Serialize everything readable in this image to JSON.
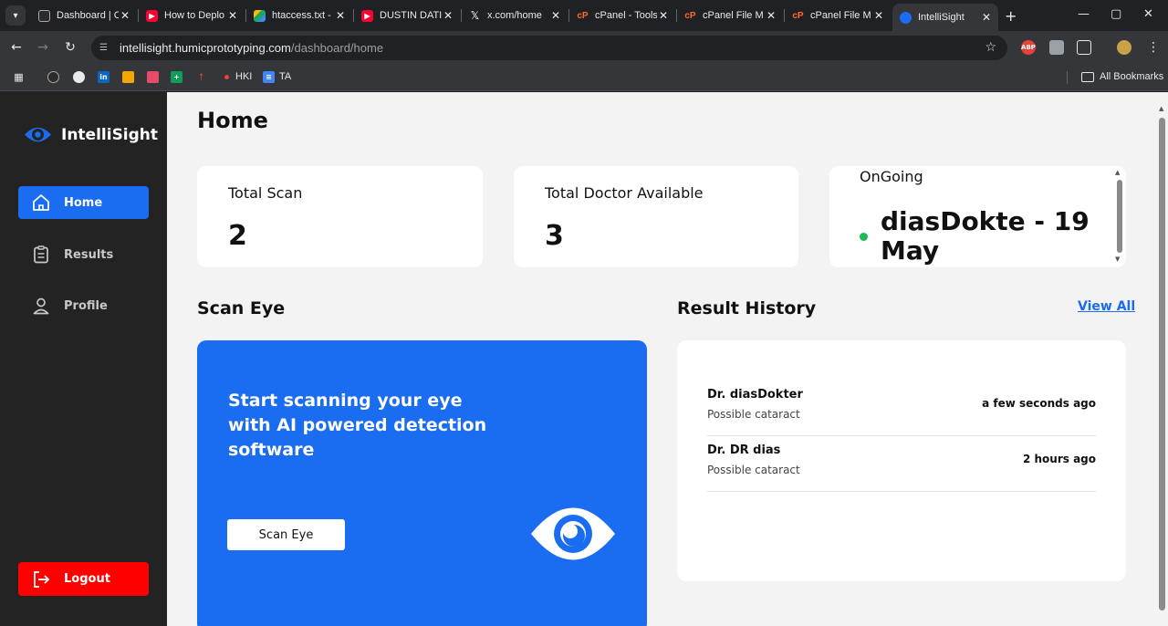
{
  "browser": {
    "tabs": [
      {
        "title": "Dashboard | C",
        "favicon": "github-favicon",
        "color": "#2b2b2b"
      },
      {
        "title": "How to Deplo",
        "favicon": "youtube-favicon",
        "color": "#ff0033"
      },
      {
        "title": "htaccess.txt -",
        "favicon": "drive-favicon",
        "color": "#1fa463"
      },
      {
        "title": "DUSTIN DATI",
        "favicon": "youtube-favicon",
        "color": "#ff0033"
      },
      {
        "title": "x.com/home",
        "favicon": "x-favicon",
        "color": "#000000"
      },
      {
        "title": "cPanel - Tools",
        "favicon": "cpanel-favicon",
        "color": "#ff6c2c"
      },
      {
        "title": "cPanel File M",
        "favicon": "cpanel-favicon",
        "color": "#ff6c2c"
      },
      {
        "title": "cPanel File M",
        "favicon": "cpanel-favicon",
        "color": "#ff6c2c"
      },
      {
        "title": "IntelliSight",
        "favicon": "intellisight-favicon",
        "color": "#1a6cf0",
        "active": true
      }
    ],
    "url_host": "intellisight.humicprototyping.com",
    "url_path": "/dashboard/home",
    "bookmarks": [
      {
        "label": "HKI",
        "color": "#ea4335"
      },
      {
        "label": "TA",
        "color": "#4285f4"
      }
    ],
    "all_bookmarks": "All Bookmarks",
    "ext_abp": "ABP"
  },
  "sidebar": {
    "brand": "IntelliSight",
    "items": [
      {
        "label": "Home",
        "icon": "home-icon"
      },
      {
        "label": "Results",
        "icon": "clipboard-icon"
      },
      {
        "label": "Profile",
        "icon": "user-icon"
      }
    ],
    "logout": "Logout"
  },
  "main": {
    "title": "Home",
    "stats": {
      "total_scan_label": "Total Scan",
      "total_scan_value": "2",
      "total_doctor_label": "Total Doctor Available",
      "total_doctor_value": "3",
      "ongoing_label": "OnGoing",
      "ongoing_value": "diasDokte - 19 May",
      "ongoing_status_color": "#1db954"
    },
    "scan": {
      "section_title": "Scan Eye",
      "text": "Start scanning your eye with AI powered detection software",
      "button": "Scan Eye"
    },
    "history": {
      "section_title": "Result History",
      "view_all": "View All",
      "items": [
        {
          "doctor": "Dr. diasDokter",
          "result": "Possible cataract",
          "time": "a few seconds ago"
        },
        {
          "doctor": "Dr. DR dias",
          "result": "Possible cataract",
          "time": "2 hours ago"
        }
      ]
    }
  },
  "colors": {
    "accent": "#1a6cf0",
    "danger": "#ff0000",
    "sidebar_bg": "#232323",
    "page_bg": "#f3f3f3"
  }
}
